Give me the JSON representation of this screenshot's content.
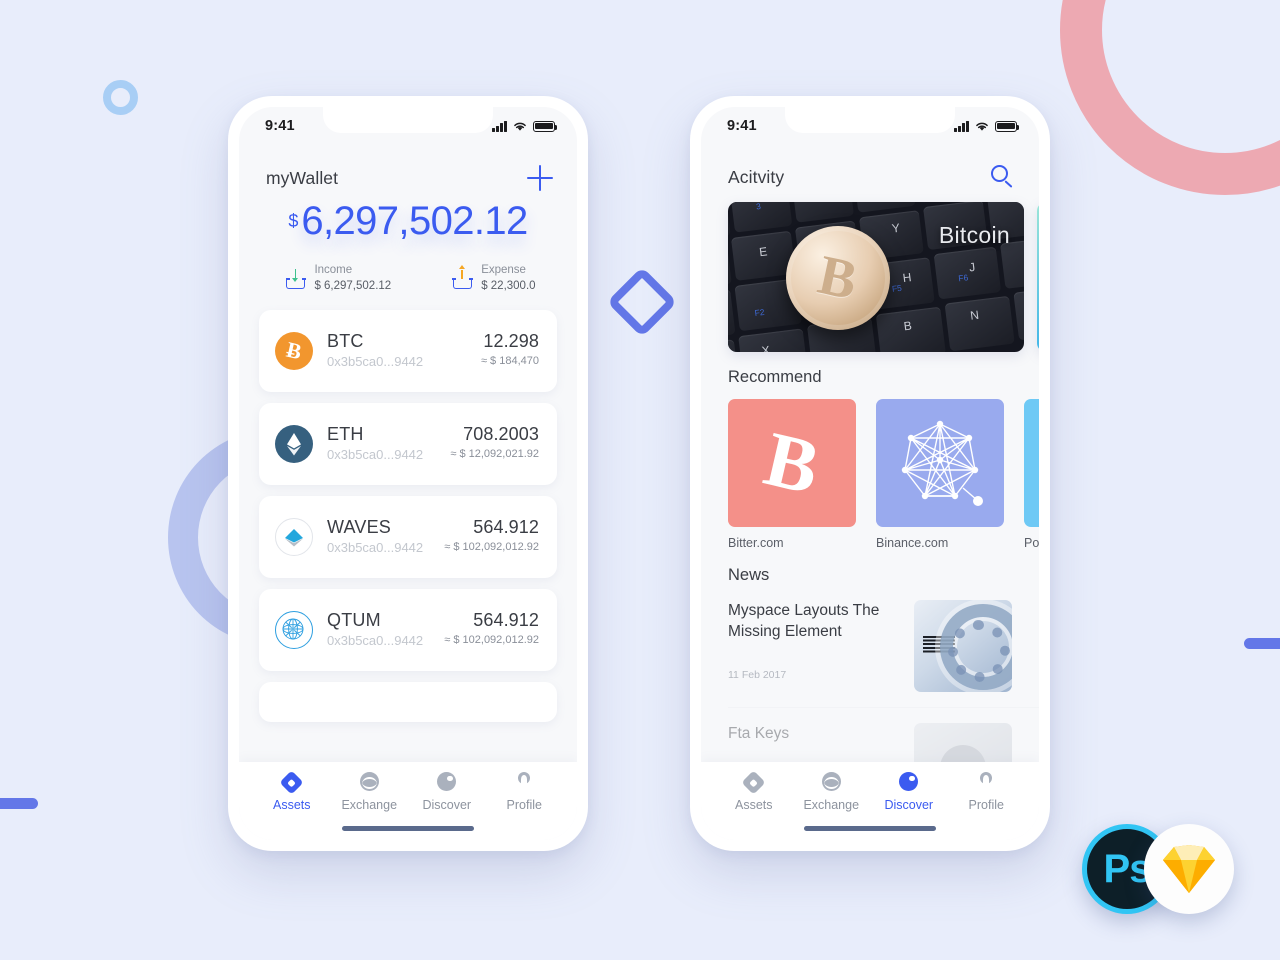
{
  "app": {
    "status_bar": {
      "time": "9:41",
      "signal_icon": "cellular-bars-icon",
      "wifi_icon": "wifi-icon",
      "battery_icon": "battery-icon"
    }
  },
  "wallet_screen": {
    "title": "myWallet",
    "add_button_icon": "plus-icon",
    "balance": {
      "currency_symbol": "$",
      "amount": "6,297,502.12"
    },
    "summary": [
      {
        "icon": "income-arrow-down-icon",
        "label": "Income",
        "value": "$ 6,297,502.12",
        "accent": "#3ec18e"
      },
      {
        "icon": "expense-arrow-up-icon",
        "label": "Expense",
        "value": "$ 22,300.0",
        "accent": "#f5a623"
      }
    ],
    "assets": [
      {
        "icon": "btc-coin-icon",
        "symbol_glyph": "Ƀ",
        "name": "BTC",
        "address": "0x3b5ca0...9442",
        "amount": "12.298",
        "fiat": "≈ $ 184,470",
        "color": "#f2962e"
      },
      {
        "icon": "eth-coin-icon",
        "symbol_glyph": "◆",
        "name": "ETH",
        "address": "0x3b5ca0...9442",
        "amount": "708.2003",
        "fiat": "≈ $ 12,092,021.92",
        "color": "#36607f"
      },
      {
        "icon": "waves-coin-icon",
        "symbol_glyph": "◆",
        "name": "WAVES",
        "address": "0x3b5ca0...9442",
        "amount": "564.912",
        "fiat": "≈ $ 102,092,012.92",
        "color": "#ffffff"
      },
      {
        "icon": "qtum-coin-icon",
        "symbol_glyph": "⊕",
        "name": "QTUM",
        "address": "0x3b5ca0...9442",
        "amount": "564.912",
        "fiat": "≈ $ 102,092,012.92",
        "color": "#ffffff"
      }
    ],
    "tabs": [
      {
        "icon": "assets-diamond-icon",
        "label": "Assets",
        "active": true
      },
      {
        "icon": "exchange-wave-icon",
        "label": "Exchange",
        "active": false
      },
      {
        "icon": "discover-circle-icon",
        "label": "Discover",
        "active": false
      },
      {
        "icon": "profile-person-icon",
        "label": "Profile",
        "active": false
      }
    ]
  },
  "discover_screen": {
    "title": "Acitvity",
    "search_button_icon": "search-icon",
    "hero": {
      "caption": "Bitcoin",
      "image": "bitcoin-coin-on-keyboard-photo"
    },
    "sections": {
      "recommend_heading": "Recommend",
      "news_heading": "News"
    },
    "recommend": [
      {
        "caption": "Bitter.com",
        "tile_icon": "bitcoin-b-icon",
        "color": "#f49089"
      },
      {
        "caption": "Binance.com",
        "tile_icon": "network-graph-icon",
        "color": "#99aaee"
      },
      {
        "caption": "Polonie",
        "tile_icon": "sparkle-icon",
        "color": "#6ec9f5"
      }
    ],
    "news": [
      {
        "title": "Myspace Layouts The Missing Element",
        "date": "11 Feb 2017",
        "thumb": "ibm-server-rack-photo"
      },
      {
        "title": "Fta Keys",
        "date": "",
        "thumb": "portrait-photo"
      }
    ],
    "tabs": [
      {
        "icon": "assets-diamond-icon",
        "label": "Assets",
        "active": false
      },
      {
        "icon": "exchange-wave-icon",
        "label": "Exchange",
        "active": false
      },
      {
        "icon": "discover-circle-icon",
        "label": "Discover",
        "active": true
      },
      {
        "icon": "profile-person-icon",
        "label": "Profile",
        "active": false
      }
    ]
  },
  "branding": {
    "photoshop_badge_label": "Ps",
    "sketch_badge_icon": "sketch-diamond-icon"
  },
  "colors": {
    "background": "#e8edfb",
    "accent_blue": "#3b5bf0",
    "deco_pink": "#eda9b2",
    "deco_periwinkle": "#b8c4ef",
    "deco_light_blue": "#a8cef5",
    "deco_indigo": "#6377e8"
  }
}
